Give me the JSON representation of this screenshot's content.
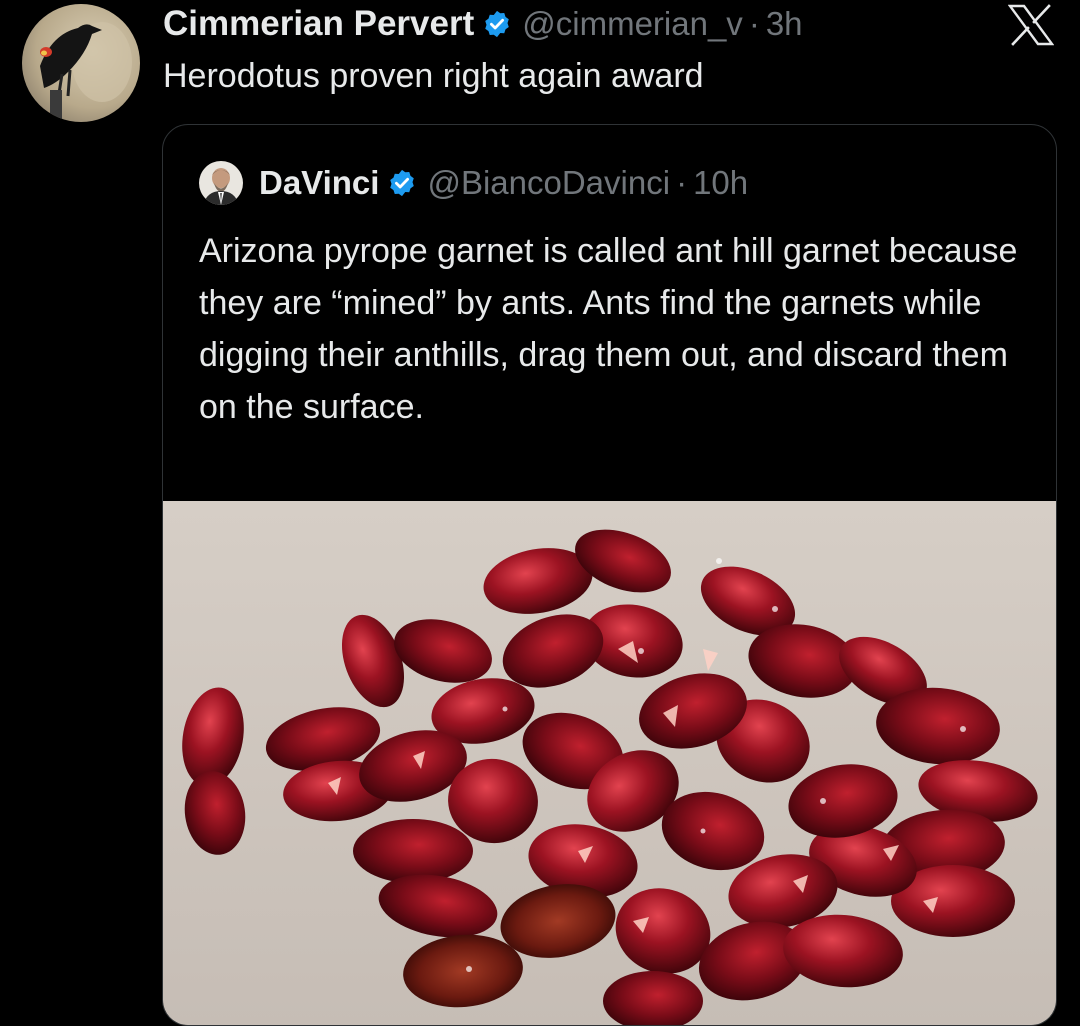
{
  "tweet": {
    "author_name": "Cimmerian Pervert",
    "handle": "@cimmerian_v",
    "separator": "·",
    "time": "3h",
    "text": "Herodotus proven right again award",
    "verified": true
  },
  "quoted_tweet": {
    "author_name": "DaVinci",
    "handle": "@BiancoDavinci",
    "separator": "·",
    "time": "10h",
    "text": "Arizona pyrope garnet is called ant hill garnet because they are “mined” by ants. Ants find the garnets while digging their anthills, drag them out, and discard them on the surface.",
    "verified": true,
    "media": "photo of red pyrope garnets on grey background"
  },
  "icons": {
    "brand": "x-logo-icon",
    "verified": "verified-badge-icon"
  },
  "colors": {
    "background": "#000000",
    "primary_text": "#e7e9ea",
    "secondary_text": "#71767b",
    "verified_blue": "#1d9bf0",
    "card_border": "#2f3336",
    "garnet_red": "#8a0f1c"
  }
}
